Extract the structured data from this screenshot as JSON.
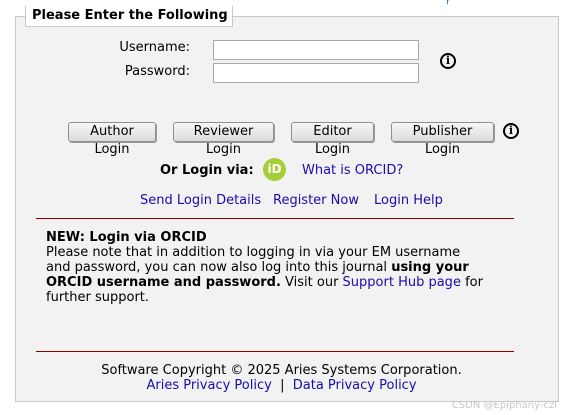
{
  "panel": {
    "legend": "Please Enter the Following",
    "top_mark": "?"
  },
  "login": {
    "username_label": "Username:",
    "username_value": "",
    "password_label": "Password:",
    "password_value": ""
  },
  "buttons": {
    "author": "Author Login",
    "reviewer": "Reviewer Login",
    "editor": "Editor Login",
    "publisher": "Publisher Login"
  },
  "info_icon_glyph": "i",
  "orcid": {
    "label": "Or Login via:",
    "icon_text": "iD",
    "icon_color": "#a6ce39",
    "what_link": "What is ORCID?"
  },
  "links": {
    "send_details": "Send Login Details",
    "register": "Register Now",
    "help": "Login Help"
  },
  "notice": {
    "title": "NEW: Login via ORCID",
    "text_1": "Please note that in addition to logging in via your EM username and password, you can now also log into this journal ",
    "text_bold": "using your ORCID username and password.",
    "text_2": " Visit our ",
    "support_link": "Support Hub page",
    "text_3": " for further support."
  },
  "footer": {
    "copyright": "Software Copyright © 2025 Aries Systems Corporation.",
    "privacy_link": "Aries Privacy Policy",
    "separator": "|",
    "data_privacy_link": "Data Privacy Policy"
  },
  "watermark": "CSDN @Epiphany-czl",
  "colors": {
    "link": "#1a0dab",
    "rule": "#8b0000",
    "panel_bg": "#f2f2f2"
  }
}
